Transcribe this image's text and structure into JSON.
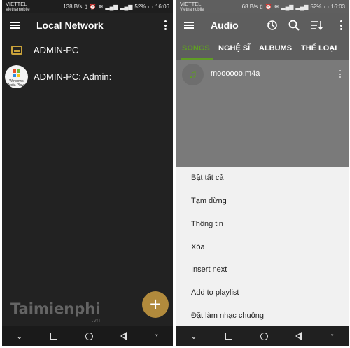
{
  "left": {
    "status": {
      "carrier": "VIETTEL",
      "carrier_sub": "Vietnamobile",
      "speed": "138 B/s",
      "battery": "52%",
      "time": "16:06"
    },
    "appbar": {
      "title": "Local Network"
    },
    "items": [
      {
        "label": "ADMIN-PC",
        "icon": "smb-server-icon"
      },
      {
        "label": "ADMIN-PC: Admin:",
        "icon": "windows-media-player-icon",
        "icon_caption": "Windows Media Player"
      }
    ],
    "fab": {
      "label": "+"
    },
    "watermark": {
      "text": "Taimienphi",
      "suffix": ".vn"
    }
  },
  "right": {
    "status": {
      "carrier": "VIETTEL",
      "carrier_sub": "Vietnamobile",
      "speed": "68 B/s",
      "battery": "52%",
      "time": "16:03"
    },
    "appbar": {
      "title": "Audio"
    },
    "tabs": [
      "SONGS",
      "NGHỆ SĨ",
      "ALBUMS",
      "THỂ LOẠI"
    ],
    "song": {
      "title": "moooooo.m4a"
    },
    "menu": [
      "Bật tất cả",
      "Tạm dừng",
      "Thông tin",
      "Xóa",
      "Insert next",
      "Add to playlist",
      "Đặt làm nhạc chuông"
    ]
  },
  "colors": {
    "accent_green": "#5f9c25",
    "fab_gold": "#b18a3c",
    "dark_bg": "#222222",
    "dimmed_bg": "#7a7a7a",
    "sheet_bg": "#f1f1f1"
  },
  "navbar": {
    "icons": [
      "chevron-down-icon",
      "square-icon",
      "circle-icon",
      "back-icon",
      "notification-pull-icon"
    ]
  }
}
